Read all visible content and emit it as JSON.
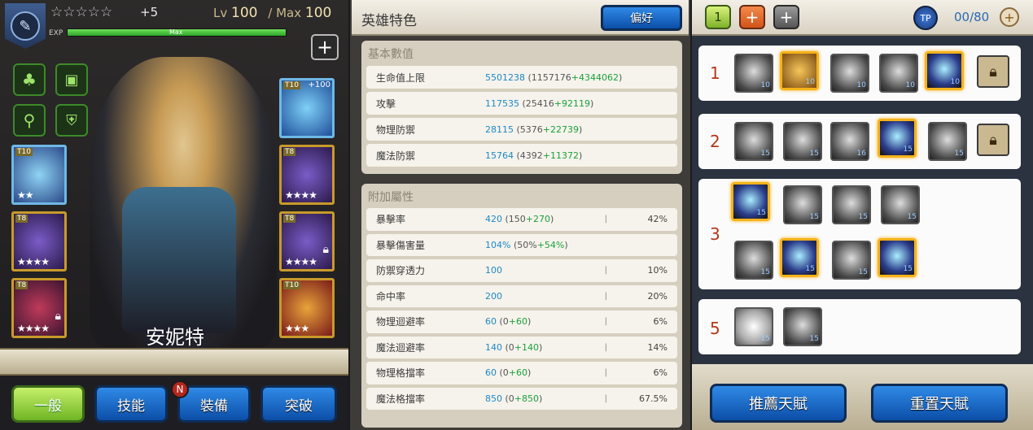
{
  "hero": {
    "star_bonus": "+5",
    "level_label": "Lv",
    "level": "100",
    "max_label": "/ Max",
    "max_level": "100",
    "exp_label": "EXP",
    "exp_status": "Max",
    "name": "安妮特"
  },
  "cards": [
    {
      "tier": "T10",
      "stars": "★★",
      "plus": "+100",
      "locked": false
    },
    {
      "tier": "T10",
      "stars": "★★",
      "plus": "",
      "locked": false
    },
    {
      "tier": "T8",
      "stars": "★★★★",
      "plus": "",
      "locked": false
    },
    {
      "tier": "T8",
      "stars": "★★★★",
      "plus": "",
      "locked": false
    },
    {
      "tier": "T8",
      "stars": "★★★★",
      "plus": "",
      "locked": true
    },
    {
      "tier": "T8",
      "stars": "★★★★",
      "plus": "",
      "locked": true
    },
    {
      "tier": "T10",
      "stars": "★★★",
      "plus": "",
      "locked": false
    }
  ],
  "bottom_tabs": {
    "general": "一般",
    "skills": "技能",
    "equipment": "裝備",
    "breakthrough": "突破",
    "badge": "N"
  },
  "traits": {
    "title": "英雄特色",
    "preference_button": "偏好",
    "base_section": "基本數值",
    "extra_section": "附加屬性",
    "base_stats": [
      {
        "label": "生命值上限",
        "value": "5501238",
        "base": "1157176",
        "bonus": "+4344062"
      },
      {
        "label": "攻擊",
        "value": "117535",
        "base": "25416",
        "bonus": "+92119"
      },
      {
        "label": "物理防禦",
        "value": "28115",
        "base": "5376",
        "bonus": "+22739"
      },
      {
        "label": "魔法防禦",
        "value": "15764",
        "base": "4392",
        "bonus": "+11372"
      }
    ],
    "extra_stats": [
      {
        "label": "暴擊率",
        "value": "420",
        "base": "150",
        "bonus": "+270",
        "pct": "42%"
      },
      {
        "label": "暴擊傷害量",
        "value": "104%",
        "base": "50%",
        "bonus": "+54%",
        "pct": ""
      },
      {
        "label": "防禦穿透力",
        "value": "100",
        "base": "",
        "bonus": "",
        "pct": "10%"
      },
      {
        "label": "命中率",
        "value": "200",
        "base": "",
        "bonus": "",
        "pct": "20%"
      },
      {
        "label": "物理迴避率",
        "value": "60",
        "base": "0",
        "bonus": "+60",
        "pct": "6%"
      },
      {
        "label": "魔法迴避率",
        "value": "140",
        "base": "0",
        "bonus": "+140",
        "pct": "14%"
      },
      {
        "label": "物理格擋率",
        "value": "60",
        "base": "0",
        "bonus": "+60",
        "pct": "6%"
      },
      {
        "label": "魔法格擋率",
        "value": "850",
        "base": "0",
        "bonus": "+850",
        "pct": "67.5%"
      }
    ]
  },
  "talents": {
    "tab1": "1",
    "tp_label": "TP",
    "tp_value": "00/80",
    "tiers": [
      {
        "num": "1",
        "levels": [
          "10",
          "10",
          "10",
          "10",
          "10"
        ]
      },
      {
        "num": "2",
        "levels": [
          "15",
          "15",
          "16",
          "15",
          "15"
        ]
      },
      {
        "num": "3",
        "levels": [
          "15",
          "15",
          "15",
          "15",
          "15",
          "15",
          "15",
          "15"
        ]
      },
      {
        "num": "5",
        "levels": [
          "15",
          "15"
        ]
      }
    ],
    "recommend_button": "推薦天賦",
    "reset_button": "重置天賦"
  }
}
